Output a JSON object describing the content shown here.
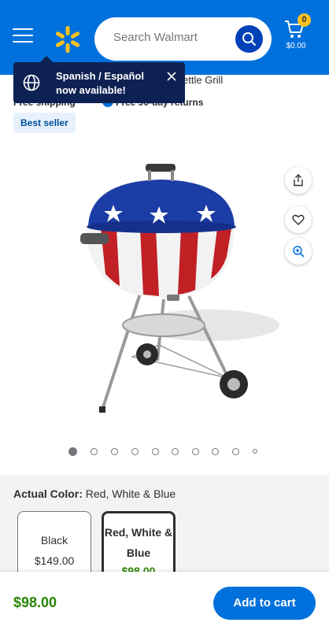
{
  "header": {
    "search_placeholder": "Search Walmart",
    "cart_count": "0",
    "cart_total": "$0.00",
    "bg_color": "#0071dc",
    "spark_color": "#ffc220"
  },
  "tooltip": {
    "text": "Spanish / Español now available!"
  },
  "product": {
    "title_partial": "ettle Grill",
    "shipping": "Free shipping",
    "returns": "Free 90-day returns",
    "badge": "Best seller"
  },
  "carousel": {
    "total": 10,
    "active_index": 0
  },
  "variants": {
    "label": "Actual Color:",
    "selected_value": "Red, White & Blue",
    "options": [
      {
        "name": "Black",
        "price": "$149.00"
      },
      {
        "name": "Red, White & Blue",
        "price": "$98.00"
      }
    ]
  },
  "bottom": {
    "price": "$98.00",
    "add_to_cart": "Add to cart"
  }
}
